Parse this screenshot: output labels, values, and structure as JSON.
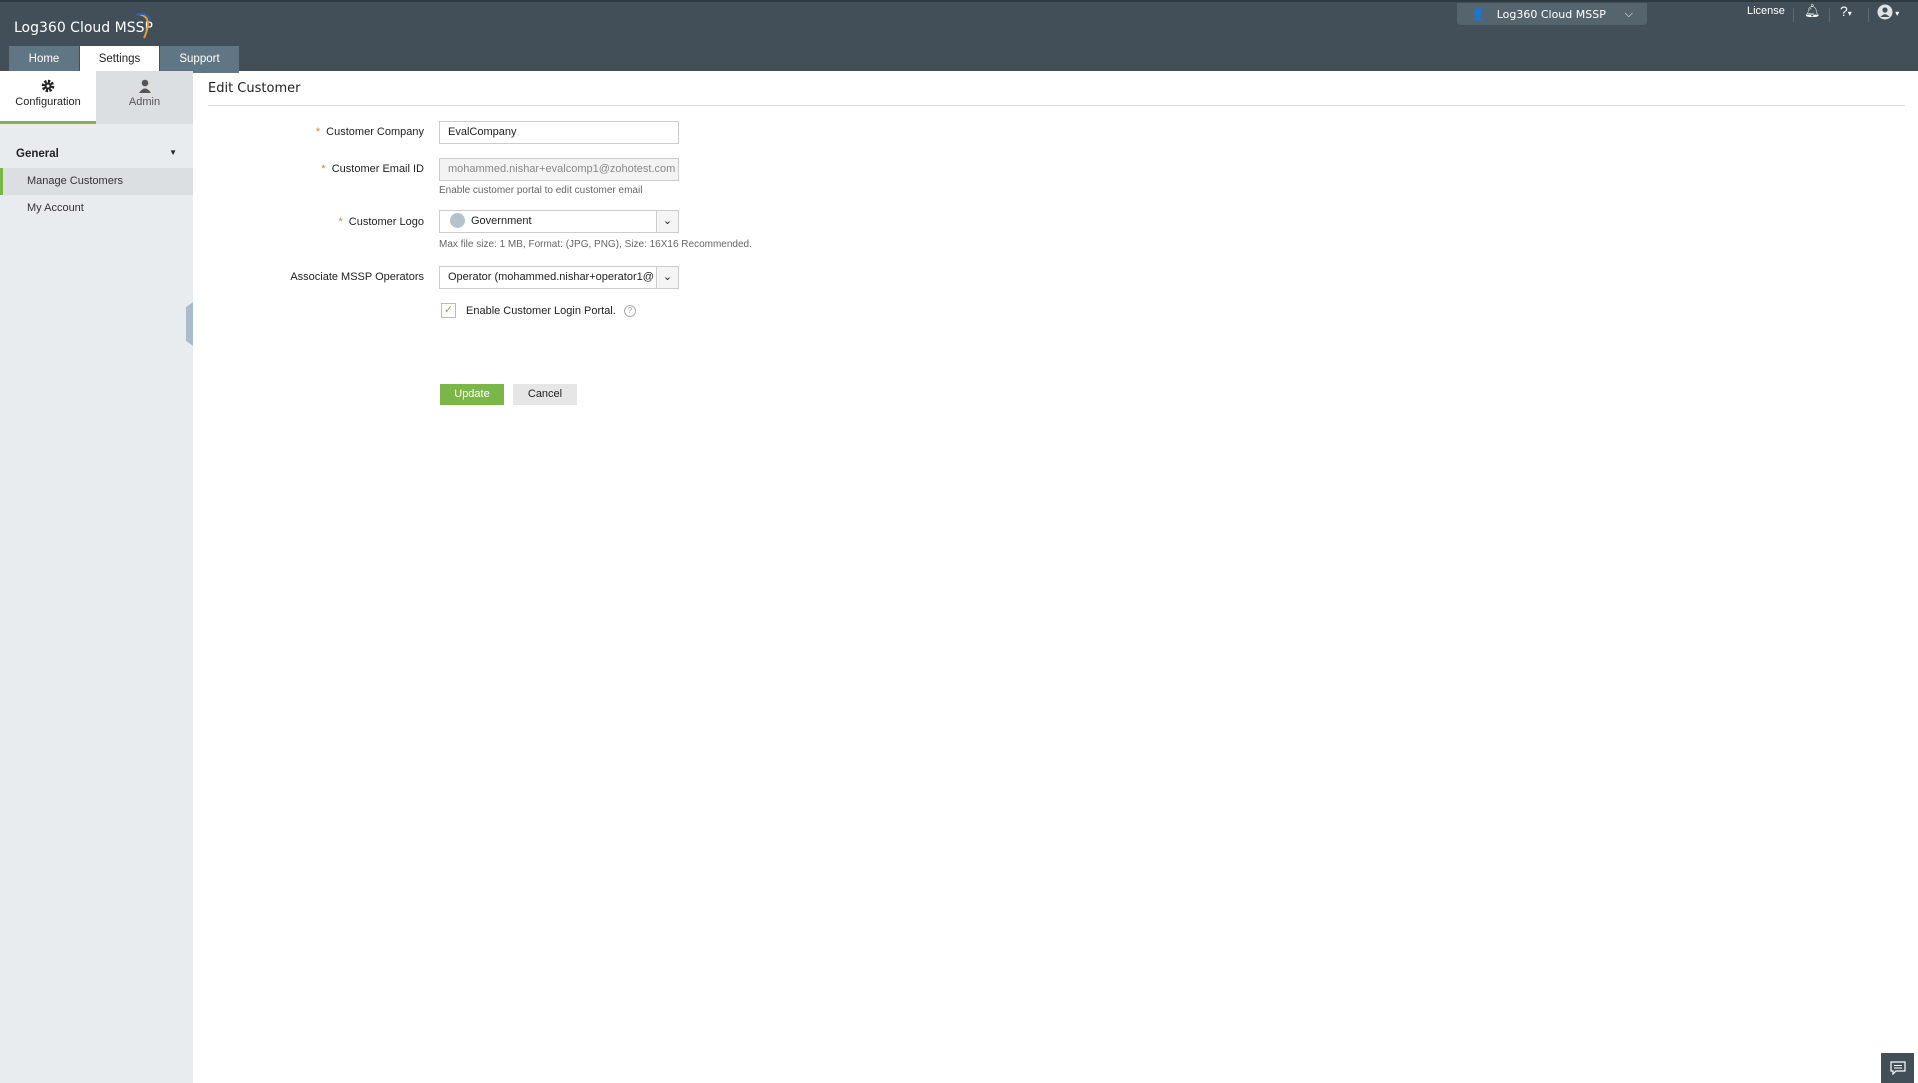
{
  "header": {
    "app_title": "Log360 Cloud MSSP",
    "tabs": [
      "Home",
      "Settings",
      "Support"
    ],
    "active_tab": "Settings",
    "org_switcher": "Log360 Cloud MSSP",
    "license": "License",
    "help": "?"
  },
  "sidebar": {
    "tabs": [
      "Configuration",
      "Admin"
    ],
    "group": "General",
    "items": [
      "Manage Customers",
      "My Account"
    ]
  },
  "page": {
    "title": "Edit Customer"
  },
  "form": {
    "company_label": "Customer Company",
    "company_value": "EvalCompany",
    "email_label": "Customer Email ID",
    "email_value": "mohammed.nishar+evalcomp1@zohotest.com",
    "email_hint": "Enable customer portal to edit customer email",
    "logo_label": "Customer Logo",
    "logo_value": "Government",
    "logo_hint": "Max file size: 1 MB, Format: (JPG, PNG), Size: 16X16 Recommended.",
    "operators_label": "Associate MSSP Operators",
    "operators_value": "Operator (mohammed.nishar+operator1@",
    "portal_label": "Enable Customer Login Portal.",
    "portal_checked": true,
    "update": "Update",
    "cancel": "Cancel",
    "required": "*"
  },
  "colors": {
    "accent": "#7ab648",
    "header": "#424f58"
  }
}
